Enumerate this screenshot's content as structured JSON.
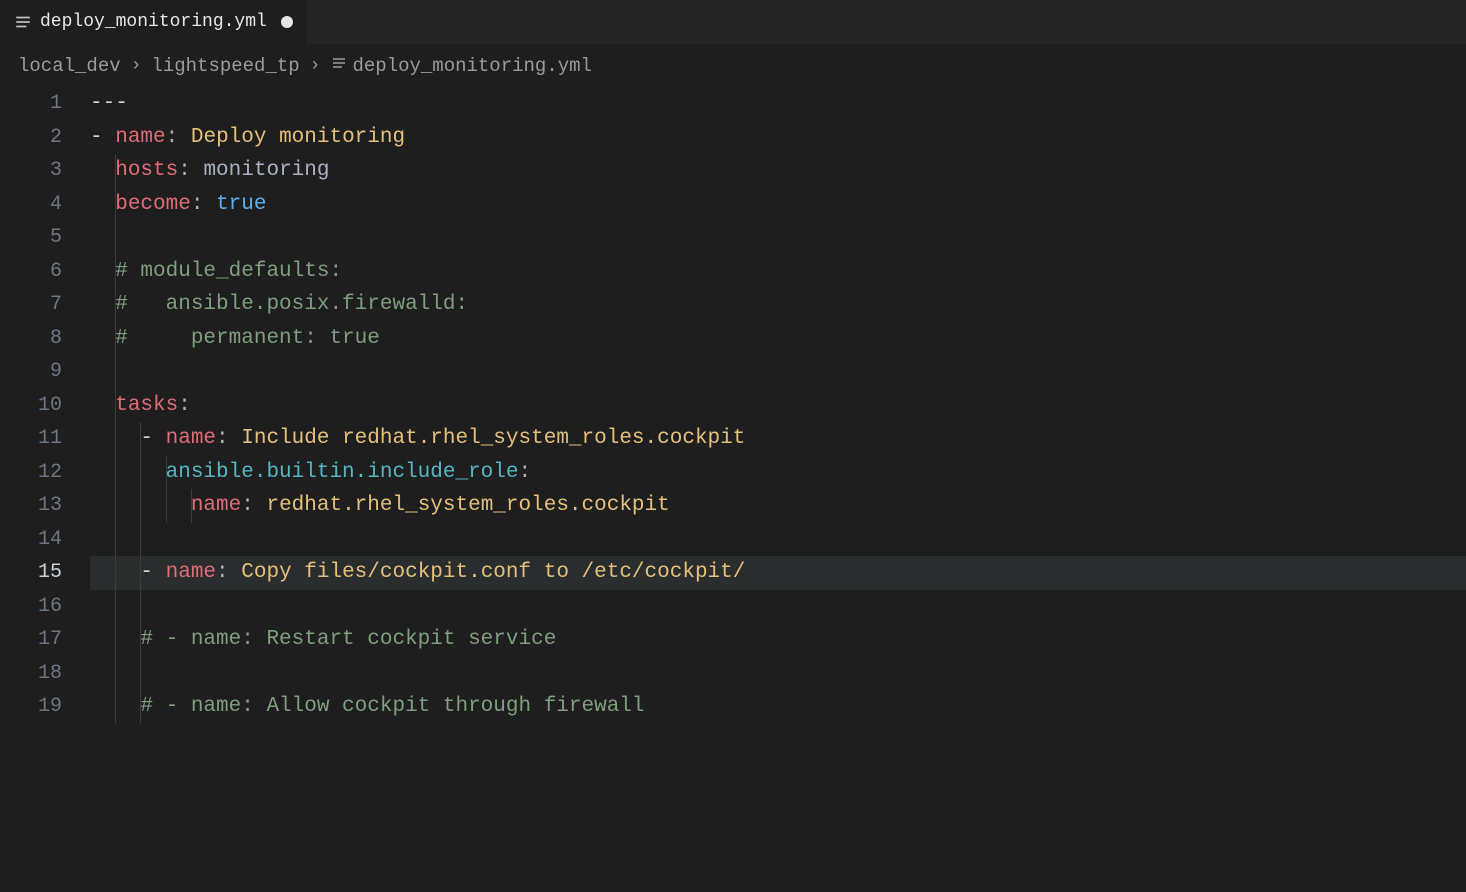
{
  "tab": {
    "label": "deploy_monitoring.yml",
    "dirty": true
  },
  "breadcrumbs": {
    "items": [
      "local_dev",
      "lightspeed_tp",
      "deploy_monitoring.yml"
    ]
  },
  "editor": {
    "activeLine": 15,
    "lines": [
      {
        "num": "1",
        "tokens": [
          {
            "cls": "c-dash",
            "txt": "---"
          }
        ],
        "guides": []
      },
      {
        "num": "2",
        "tokens": [
          {
            "cls": "c-dash",
            "txt": "- "
          },
          {
            "cls": "c-key",
            "txt": "name"
          },
          {
            "cls": "c-colon",
            "txt": ": "
          },
          {
            "cls": "c-string",
            "txt": "Deploy monitoring"
          }
        ],
        "guides": []
      },
      {
        "num": "3",
        "tokens": [
          {
            "cls": "c-dash",
            "txt": "  "
          },
          {
            "cls": "c-key",
            "txt": "hosts"
          },
          {
            "cls": "c-colon",
            "txt": ": "
          },
          {
            "cls": "c-plain",
            "txt": "monitoring"
          }
        ],
        "guides": [
          1
        ]
      },
      {
        "num": "4",
        "tokens": [
          {
            "cls": "c-dash",
            "txt": "  "
          },
          {
            "cls": "c-key",
            "txt": "become"
          },
          {
            "cls": "c-colon",
            "txt": ": "
          },
          {
            "cls": "c-bool",
            "txt": "true"
          }
        ],
        "guides": [
          1
        ]
      },
      {
        "num": "5",
        "tokens": [],
        "guides": [
          1
        ]
      },
      {
        "num": "6",
        "tokens": [
          {
            "cls": "c-dash",
            "txt": "  "
          },
          {
            "cls": "c-comment",
            "txt": "# module_defaults:"
          }
        ],
        "guides": [
          1
        ]
      },
      {
        "num": "7",
        "tokens": [
          {
            "cls": "c-dash",
            "txt": "  "
          },
          {
            "cls": "c-comment",
            "txt": "#   ansible.posix.firewalld:"
          }
        ],
        "guides": [
          1
        ]
      },
      {
        "num": "8",
        "tokens": [
          {
            "cls": "c-dash",
            "txt": "  "
          },
          {
            "cls": "c-comment",
            "txt": "#     permanent: true"
          }
        ],
        "guides": [
          1
        ]
      },
      {
        "num": "9",
        "tokens": [],
        "guides": [
          1
        ]
      },
      {
        "num": "10",
        "tokens": [
          {
            "cls": "c-dash",
            "txt": "  "
          },
          {
            "cls": "c-key",
            "txt": "tasks"
          },
          {
            "cls": "c-colon",
            "txt": ":"
          }
        ],
        "guides": [
          1
        ]
      },
      {
        "num": "11",
        "tokens": [
          {
            "cls": "c-dash",
            "txt": "    - "
          },
          {
            "cls": "c-key",
            "txt": "name"
          },
          {
            "cls": "c-colon",
            "txt": ": "
          },
          {
            "cls": "c-string",
            "txt": "Include redhat.rhel_system_roles.cockpit"
          }
        ],
        "guides": [
          1,
          2
        ]
      },
      {
        "num": "12",
        "tokens": [
          {
            "cls": "c-dash",
            "txt": "      "
          },
          {
            "cls": "c-builtin",
            "txt": "ansible.builtin.include_role"
          },
          {
            "cls": "c-colon",
            "txt": ":"
          }
        ],
        "guides": [
          1,
          2,
          3
        ]
      },
      {
        "num": "13",
        "tokens": [
          {
            "cls": "c-dash",
            "txt": "        "
          },
          {
            "cls": "c-key",
            "txt": "name"
          },
          {
            "cls": "c-colon",
            "txt": ": "
          },
          {
            "cls": "c-string",
            "txt": "redhat.rhel_system_roles.cockpit"
          }
        ],
        "guides": [
          1,
          2,
          3,
          4
        ]
      },
      {
        "num": "14",
        "tokens": [],
        "guides": [
          1,
          2
        ]
      },
      {
        "num": "15",
        "tokens": [
          {
            "cls": "c-dash",
            "txt": "    - "
          },
          {
            "cls": "c-key",
            "txt": "name"
          },
          {
            "cls": "c-colon",
            "txt": ": "
          },
          {
            "cls": "c-string",
            "txt": "Copy files/cockpit.conf to /etc/cockpit/"
          }
        ],
        "guides": [
          1,
          2
        ]
      },
      {
        "num": "16",
        "tokens": [],
        "guides": [
          1,
          2
        ]
      },
      {
        "num": "17",
        "tokens": [
          {
            "cls": "c-dash",
            "txt": "    "
          },
          {
            "cls": "c-comment",
            "txt": "# - name: Restart cockpit service"
          }
        ],
        "guides": [
          1,
          2
        ]
      },
      {
        "num": "18",
        "tokens": [],
        "guides": [
          1,
          2
        ]
      },
      {
        "num": "19",
        "tokens": [
          {
            "cls": "c-dash",
            "txt": "    "
          },
          {
            "cls": "c-comment",
            "txt": "# - name: Allow cockpit through firewall"
          }
        ],
        "guides": [
          1,
          2
        ]
      }
    ]
  }
}
